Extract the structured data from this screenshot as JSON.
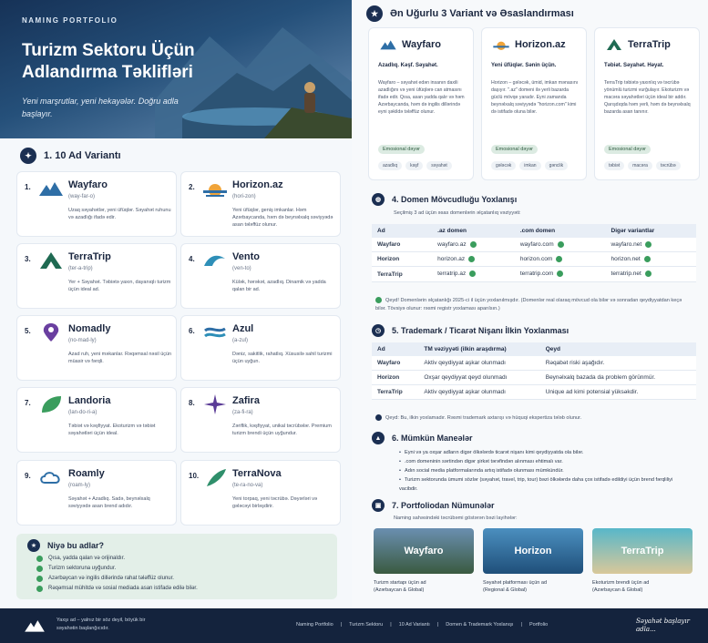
{
  "hero": {
    "kicker": "NAMING PORTFOLIO",
    "title": "Turizm Sektoru Üçün Adlandırma Təklifləri",
    "subtitle": "Yeni marşrutlar, yeni hekayələr. Doğru adla başlayır."
  },
  "section1": {
    "title": "1. 10 Ad Variantı"
  },
  "names": [
    {
      "num": "1.",
      "name": "Wayfaro",
      "pron": "(way-far-o)",
      "desc": "Uzaq səyahətlər, yeni üfüqlər. Səyahət ruhunu və azadlığı ifadə edir.",
      "logo": "mountain-logo-icon"
    },
    {
      "num": "2.",
      "name": "Horizon.az",
      "pron": "(hori-zon)",
      "desc": "Yeni üfüqlər, geniş imkanlar. Həm Azərbaycanda, həm də beynəlxalq səviyyədə asan tələffüz olunur.",
      "logo": "sunrise-logo-icon"
    },
    {
      "num": "3.",
      "name": "TerraTrip",
      "pron": "(ter-a-trip)",
      "desc": "Yer + Səyahət. Təbiətə yaxın, dayanıqlı turizm üçün ideal ad.",
      "logo": "peak-logo-icon"
    },
    {
      "num": "4.",
      "name": "Vento",
      "pron": "(ven-to)",
      "desc": "Külək, hərəkət, azadlıq. Dinamik və yadda qalan bir ad.",
      "logo": "wave-logo-icon"
    },
    {
      "num": "5.",
      "name": "Nomadly",
      "pron": "(no-mad-ly)",
      "desc": "Azad ruh, yeni məkanlar. Rəqəmsal nəsil üçün müasir və fərqli.",
      "logo": "pin-logo-icon"
    },
    {
      "num": "6.",
      "name": "Azul",
      "pron": "(a-zul)",
      "desc": "Dəniz, sakitlik, rahatlıq. Xüsusilə sahil turizmi üçün uyğun.",
      "logo": "waves-logo-icon"
    },
    {
      "num": "7.",
      "name": "Landoria",
      "pron": "(lan-do-ri-a)",
      "desc": "Təbiət və kəşfiyyat. Ekoturizm və təbiət səyahətləri üçün ideal.",
      "logo": "leaf-logo-icon"
    },
    {
      "num": "8.",
      "name": "Zafira",
      "pron": "(za-fi-ra)",
      "desc": "Zəriflik, kəşfiyyat, unikal təcrübələr. Premium turizm brendi üçün uyğundur.",
      "logo": "star-logo-icon"
    },
    {
      "num": "9.",
      "name": "Roamly",
      "pron": "(roam-ly)",
      "desc": "Səyahət + Azadlıq. Sadə, beynəlxalq səviyyədə asan brend adıdır.",
      "logo": "cloud-logo-icon"
    },
    {
      "num": "10.",
      "name": "TerraNova",
      "pron": "(te-ra-no-va)",
      "desc": "Yeni torpaq, yeni təcrübə. Dəyərləri və gələcəyi birləşdirir.",
      "logo": "feather-logo-icon"
    }
  ],
  "why": {
    "title": "Niyə bu adlar?",
    "items": [
      "Qısa, yadda qalan və orijinaldır.",
      "Turizm sektoruna uyğundur.",
      "Azərbaycan və ingilis dillərində rahat tələffüz olunur.",
      "Rəqəmsal mühitdə və sosial mediada asan istifadə edilə bilər."
    ]
  },
  "section_top3": {
    "title": "Ən Uğurlu 3 Variant və Əsaslandırması"
  },
  "top3": [
    {
      "name": "Wayfaro",
      "tagline": "Azadlıq. Kəşf. Səyahət.",
      "desc": "Wayfaro – səyahət edən insanın daxili azadlığını və yeni üfüqlərə can atmasını ifadə edir. Qısa, asan yadda qalır və həm Azərbaycanda, həm də ingilis dillərində eyni şəkildə tələffüz olunur.",
      "emo": "Emosional dəyər",
      "pills": [
        "azadlıq",
        "kəşf",
        "səyahət"
      ]
    },
    {
      "name": "Horizon.az",
      "tagline": "Yeni üfüqlər. Sənin üçün.",
      "desc": "Horizon – gələcək, ümid, imkan mənasını daşıyır. \".az\" domeni ilə yerli bazarda güclü mövqe yaradır. Eyni zamanda beynəlxalq səviyyədə \"horizon.com\" kimi də istifadə oluna bilər.",
      "emo": "Emosional dəyər",
      "pills": [
        "gələcək",
        "imkan",
        "gənclik"
      ]
    },
    {
      "name": "TerraTrip",
      "tagline": "Təbiət. Səyahət. Həyat.",
      "desc": "TerraTrip təbiətə yaxınlıq və təcrübə yönümlü turizmi vurğulayır. Ekoturizm və macəra səyahətləri üçün ideal bir addır. Qarışdıqda həm yerli, həm də beynəlxalq bazarda asan tanınır.",
      "emo": "Emosional dəyər",
      "pills": [
        "təbiət",
        "macəra",
        "təcrübə"
      ]
    }
  ],
  "section4": {
    "title": "4. Domen Mövcudluğu Yoxlanışı",
    "subtitle": "Seçilmiş 3 ad üçün əsas domenlərin əlçatanlıq vəziyyəti:",
    "headers": [
      "Ad",
      ".az domen",
      ".com domen",
      "Digər variantlar"
    ],
    "rows": [
      [
        "Wayfaro",
        "wayfaro.az",
        "wayfaro.com",
        "wayfaro.net"
      ],
      [
        "Horizon",
        "horizon.az",
        "horizon.com",
        "horizon.net"
      ],
      [
        "TerraTrip",
        "terratrip.az",
        "terratrip.com",
        "terratrip.net"
      ]
    ],
    "note": "Qeyd! Domenlərin əlçatanlığı 2025-ci il üçün yoxlanılmışdır. (Domenlər real olaraq mövcud ola bilər və sonradan qeydiyyatdan keçə bilər. Tövsiyə olunur: rəsmi registr yoxlaması aparılsın.)"
  },
  "section5": {
    "title": "5. Trademark / Ticarət Nişanı İlkin Yoxlanması",
    "headers": [
      "Ad",
      "TM vəziyyəti (ilkin araşdırma)",
      "Qeyd"
    ],
    "rows": [
      [
        "Wayfaro",
        "Aktiv qeydiyyat aşkar olunmadı",
        "Rəqabət riski aşağıdır."
      ],
      [
        "Horizon",
        "Oxşar qeydiyyat qeyd olunmadı",
        "Beynəlxalq bazada da problem görünmür."
      ],
      [
        "TerraTrip",
        "Aktiv qeydiyyat aşkar olunmadı",
        "Unique ad kimi potensial yüksəkdir."
      ]
    ],
    "note": "Qeyd: Bu, ilkin yoxlamadır. Rəsmi trademark axtarışı və hüquqi ekspertiza tələb olunur."
  },
  "section6": {
    "title": "6. Mümkün Maneələr",
    "items": [
      "Eyni və ya oxşar adların digər ölkələrdə ticarət nişanı kimi qeydiyyatda ola bilər.",
      ".com domeninin sərtindən digər şirkət tərəfindən alınması ehtimalı var.",
      "Adın social media platformalarında artıq istifadə olunması mümkündür.",
      "Turizm sektorunda ümumi sözlər (səyahət, travel, trip, tour) bəzi ölkələrdə daha çox istifadə edildiyi üçün brend fərqliliyi vacibdir."
    ]
  },
  "section7": {
    "title": "7. Portfoliodan Nümunələr",
    "subtitle": "Naming sahəsindəki təcrübəmi göstərən bəzi layihələr:",
    "items": [
      {
        "label": "Wayfaro",
        "caption1": "Turizm startapı üçün ad",
        "caption2": "(Azərbaycan & Global)"
      },
      {
        "label": "Horizon",
        "caption1": "Səyahət platforması üçün ad",
        "caption2": "(Regional & Global)"
      },
      {
        "label": "TerraTrip",
        "caption1": "Ekoturizm brendi üçün ad",
        "caption2": "(Azərbaycan & Global)"
      }
    ]
  },
  "footer": {
    "tagline": "Yaxşı ad – yalnız bir söz deyil, böyük bir səyahətin başlanğıcıdır.",
    "nav": [
      "Naming Portfolio",
      "|",
      "Turizm Sektoru",
      "|",
      "10 Ad Variantı",
      "|",
      "Domen & Trademark Yoxlanışı",
      "|",
      "Portfolio"
    ],
    "signature": "Səyahət başlayır adla..."
  },
  "colors": {
    "navy": "#14233d",
    "accent_green": "#3a9d5d",
    "sky": "#2e6ea6"
  }
}
